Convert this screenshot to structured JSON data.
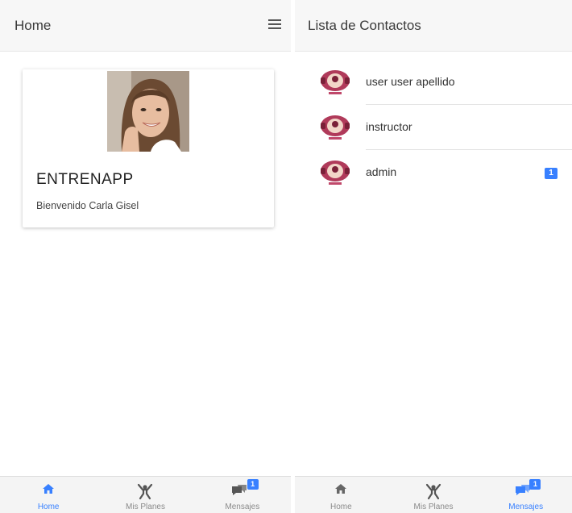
{
  "left_screen": {
    "header": {
      "title": "Home"
    },
    "card": {
      "title": "ENTRENAPP",
      "subtitle": "Bienvenido Carla Gisel"
    },
    "tabs": [
      {
        "label": "Home",
        "icon": "home-icon",
        "active": true
      },
      {
        "label": "Mis Planes",
        "icon": "gym-person-icon",
        "active": false
      },
      {
        "label": "Mensajes",
        "icon": "chat-bubbles-icon",
        "active": false,
        "badge": "1"
      }
    ]
  },
  "right_screen": {
    "header": {
      "title": "Lista de Contactos"
    },
    "contacts": [
      {
        "name": "user user apellido",
        "icon": "trainer-logo-icon"
      },
      {
        "name": "instructor",
        "icon": "trainer-logo-icon"
      },
      {
        "name": "admin",
        "icon": "trainer-logo-icon",
        "badge": "1"
      }
    ],
    "tabs": [
      {
        "label": "Home",
        "icon": "home-icon",
        "active": false
      },
      {
        "label": "Mis Planes",
        "icon": "gym-person-icon",
        "active": false
      },
      {
        "label": "Mensajes",
        "icon": "chat-bubbles-icon",
        "active": true,
        "badge": "1"
      }
    ]
  },
  "colors": {
    "accent": "#3880ff",
    "header_bg": "#f7f7f7",
    "logo": "#b03a5a"
  }
}
